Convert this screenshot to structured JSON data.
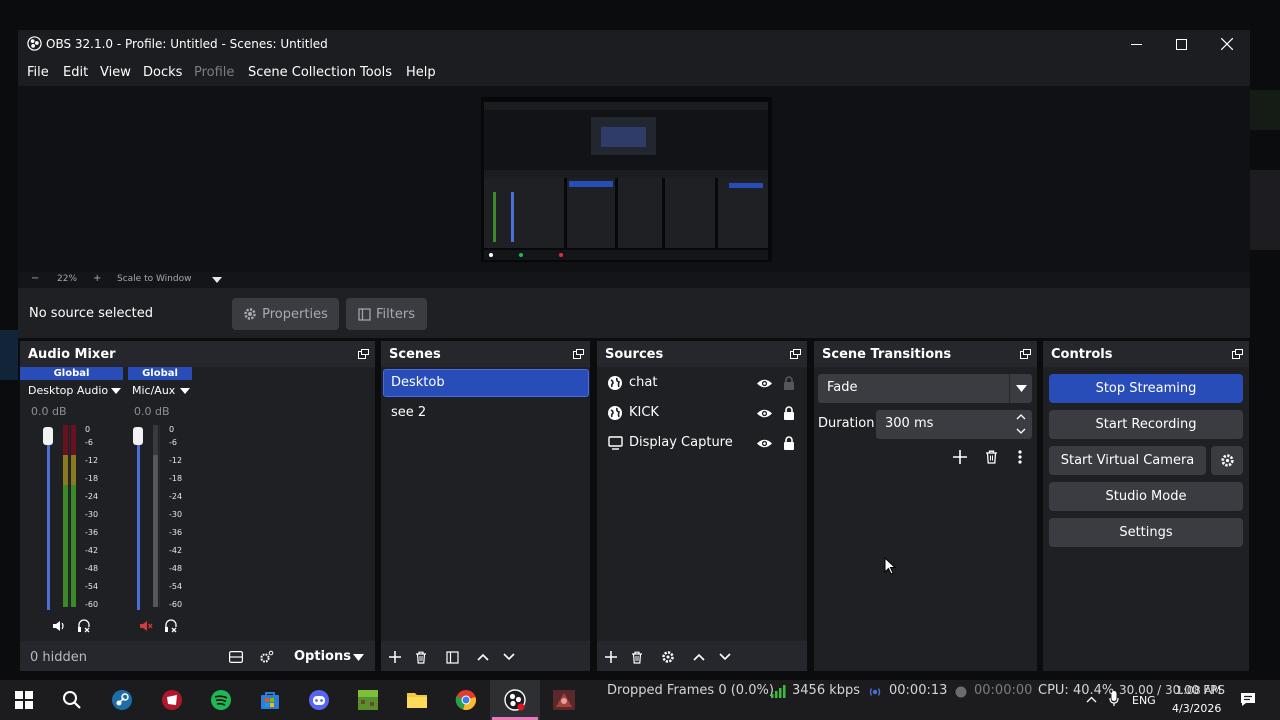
{
  "window": {
    "title": "OBS 32.1.0 - Profile: Untitled - Scenes: Untitled",
    "controls": [
      "minimize-icon",
      "maximize-icon",
      "close-icon"
    ]
  },
  "menu": [
    "File",
    "Edit",
    "View",
    "Docks",
    "Profile",
    "Scene Collection",
    "Tools",
    "Help"
  ],
  "preview": {
    "zoom_minus": "−",
    "zoom_level": "22%",
    "zoom_plus": "+",
    "scale_mode": "Scale to Window"
  },
  "context": {
    "no_source": "No source selected",
    "properties": "Properties",
    "filters": "Filters"
  },
  "audio_mixer": {
    "title": "Audio Mixer",
    "channels": [
      {
        "badge": "Global",
        "name": "Desktop Audio",
        "level": "0.0 dB",
        "muted": false
      },
      {
        "badge": "Global",
        "name": "Mic/Aux",
        "level": "0.0 dB",
        "muted": true
      }
    ],
    "ticks": [
      "0",
      "-6",
      "-12",
      "-18",
      "-24",
      "-30",
      "-36",
      "-42",
      "-48",
      "-54",
      "-60"
    ],
    "hidden": "0 hidden",
    "options": "Options"
  },
  "scenes": {
    "title": "Scenes",
    "items": [
      {
        "name": "Desktob",
        "selected": true
      },
      {
        "name": "see 2",
        "selected": false
      }
    ]
  },
  "sources": {
    "title": "Sources",
    "items": [
      {
        "name": "chat",
        "icon": "globe-icon",
        "locked": false
      },
      {
        "name": "KICK",
        "icon": "globe-icon",
        "locked": true
      },
      {
        "name": "Display Capture",
        "icon": "monitor-icon",
        "locked": true
      }
    ]
  },
  "transitions": {
    "title": "Scene Transitions",
    "selected": "Fade",
    "duration_label": "Duration",
    "duration_value": "300 ms"
  },
  "controls": {
    "title": "Controls",
    "stop_streaming": "Stop Streaming",
    "start_recording": "Start Recording",
    "start_virtual_camera": "Start Virtual Camera",
    "studio_mode": "Studio Mode",
    "settings": "Settings"
  },
  "status": {
    "dropped_frames": "Dropped Frames 0 (0.0%)",
    "bitrate": "3456 kbps",
    "stream_time": "00:00:13",
    "record_time": "00:00:00",
    "cpu": "CPU: 40.4%",
    "fps": "30.00 / 30.00 FPS"
  },
  "taskbar": {
    "language": "ENG",
    "time": "1:08 AM",
    "date": "4/3/2026",
    "apps": [
      "windows-start-icon",
      "search-icon",
      "steam-icon",
      "riot-icon",
      "spotify-icon",
      "store-icon",
      "discord-icon",
      "minecraft-icon",
      "file-explorer-icon",
      "chrome-icon",
      "obs-icon",
      "game-icon"
    ]
  },
  "colors": {
    "accent": "#284cb8",
    "panel": "#1f2024",
    "header": "#26272c",
    "meter_green": "#3a8a2a",
    "meter_blue": "#4a6fd6",
    "muted_red": "#d23b3b"
  }
}
